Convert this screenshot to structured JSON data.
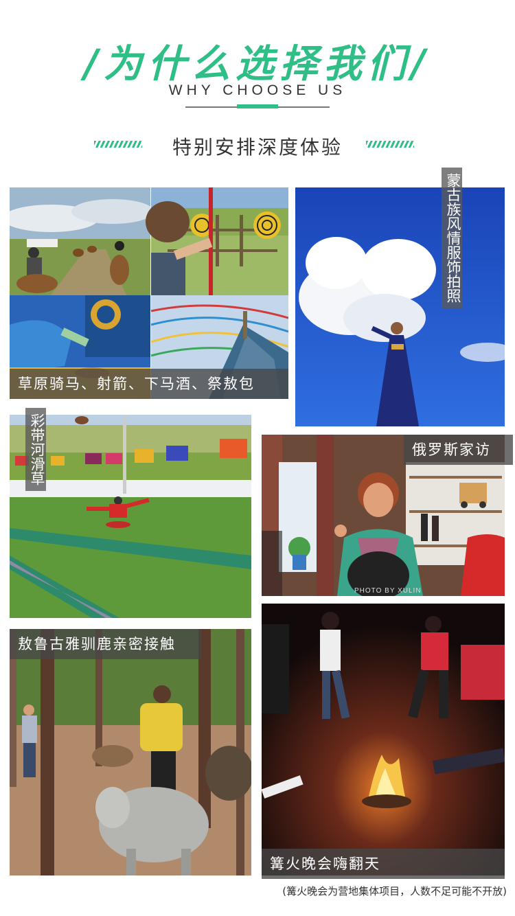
{
  "header": {
    "title": "/为什么选择我们/",
    "subtitle": "WHY CHOOSE US",
    "section_title": "特别安排深度体验"
  },
  "captions": {
    "grassland": "草原骑马、射箭、下马酒、祭敖包",
    "mongol_costume": "蒙古族风情服饰拍照",
    "slide": "彩带河滑草",
    "russian_visit": "俄罗斯家访",
    "reindeer": "敖鲁古雅驯鹿亲密接触",
    "bonfire": "篝火晚会嗨翻天"
  },
  "watermark": "PHOTO BY XULIN",
  "footnote": "(篝火晚会为营地集体项目，人数不足可能不开放)",
  "colors": {
    "accent": "#2fbf86",
    "caption_bg": "#555555",
    "text": "#333333"
  }
}
